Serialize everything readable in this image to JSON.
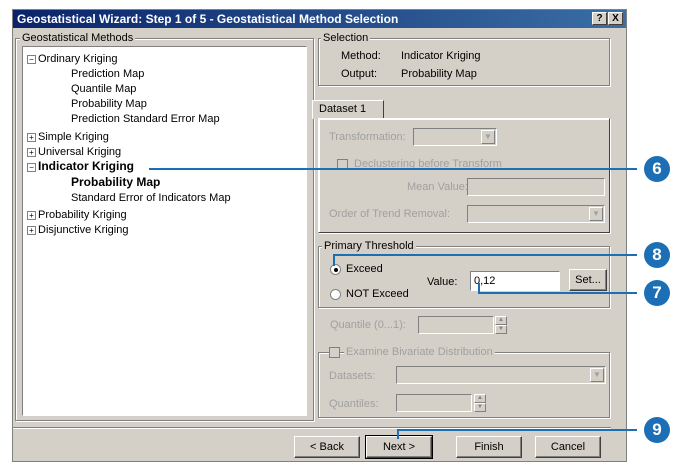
{
  "window": {
    "title": "Geostatistical Wizard: Step 1 of 5 - Geostatistical Method Selection",
    "help_label": "?",
    "close_label": "X"
  },
  "methods": {
    "legend": "Geostatistical Methods",
    "items": [
      {
        "label": "Ordinary Kriging",
        "expander": "−"
      },
      {
        "label": "Prediction Map"
      },
      {
        "label": "Quantile Map"
      },
      {
        "label": "Probability Map"
      },
      {
        "label": "Prediction Standard Error Map"
      },
      {
        "label": "Simple Kriging",
        "expander": "+"
      },
      {
        "label": "Universal Kriging",
        "expander": "+"
      },
      {
        "label": "Indicator Kriging",
        "expander": "−"
      },
      {
        "label": "Probability Map"
      },
      {
        "label": "Standard Error of Indicators Map"
      },
      {
        "label": "Probability Kriging",
        "expander": "+"
      },
      {
        "label": "Disjunctive Kriging",
        "expander": "+"
      }
    ]
  },
  "selection": {
    "legend": "Selection",
    "method_label": "Method:",
    "method_value": "Indicator Kriging",
    "output_label": "Output:",
    "output_value": "Probability Map"
  },
  "dataset": {
    "tab_label": "Dataset 1",
    "transformation_label": "Transformation:",
    "declustering_label": "Declustering before Transform",
    "mean_value_label": "Mean Value:",
    "trend_label": "Order of Trend Removal:"
  },
  "threshold": {
    "legend": "Primary Threshold",
    "exceed_label": "Exceed",
    "not_exceed_label": "NOT Exceed",
    "value_label": "Value:",
    "value": "0,12",
    "set_label": "Set..."
  },
  "quantile": {
    "label": "Quantile (0...1):"
  },
  "bivariate": {
    "checkbox_label": "Examine Bivariate Distribution",
    "datasets_label": "Datasets:",
    "quantiles_label": "Quantiles:"
  },
  "buttons": {
    "back": "< Back",
    "next": "Next >",
    "finish": "Finish",
    "cancel": "Cancel"
  },
  "callouts": [
    "6",
    "8",
    "7",
    "9"
  ],
  "colors": {
    "callout": "#1c6fb4",
    "titlebar": "#0a246a"
  }
}
